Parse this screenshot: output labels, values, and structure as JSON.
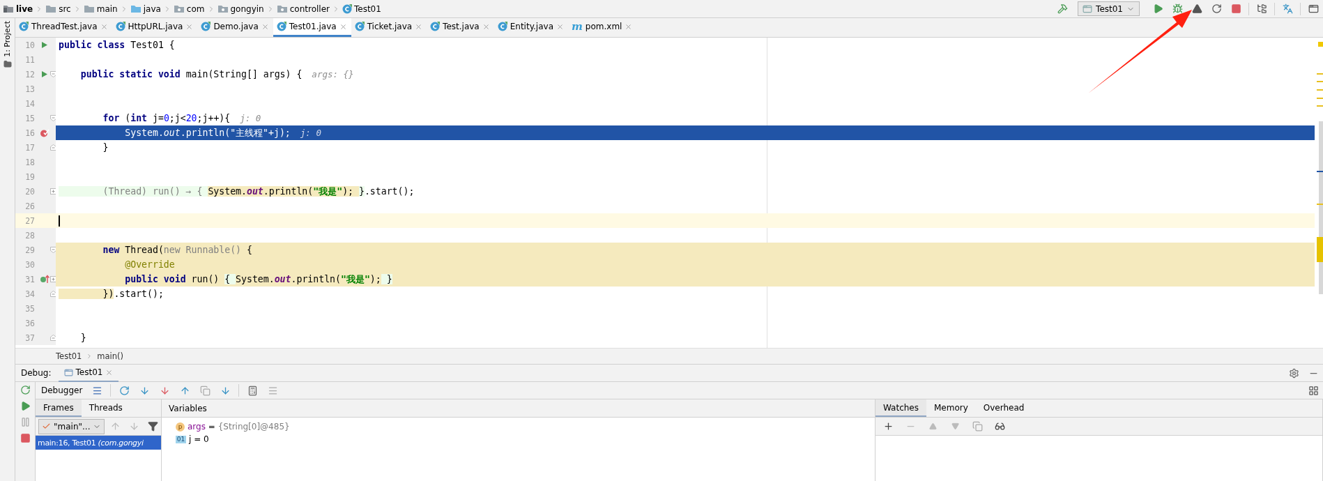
{
  "breadcrumbs": [
    {
      "label": "live",
      "kind": "project"
    },
    {
      "label": "src",
      "kind": "folder"
    },
    {
      "label": "main",
      "kind": "folder"
    },
    {
      "label": "java",
      "kind": "source"
    },
    {
      "label": "com",
      "kind": "package"
    },
    {
      "label": "gongyin",
      "kind": "package"
    },
    {
      "label": "controller",
      "kind": "package"
    },
    {
      "label": "Test01",
      "kind": "class"
    }
  ],
  "run_config": "Test01",
  "side_strip": "1: Project",
  "tabs": [
    {
      "label": "ThreadTest.java",
      "kind": "class",
      "selected": false
    },
    {
      "label": "HttpURL.java",
      "kind": "class",
      "selected": false
    },
    {
      "label": "Demo.java",
      "kind": "class",
      "selected": false
    },
    {
      "label": "Test01.java",
      "kind": "class",
      "selected": true
    },
    {
      "label": "Ticket.java",
      "kind": "class",
      "selected": false
    },
    {
      "label": "Test.java",
      "kind": "class",
      "selected": false
    },
    {
      "label": "Entity.java",
      "kind": "class",
      "selected": false
    },
    {
      "label": "pom.xml",
      "kind": "maven",
      "badge": "m",
      "selected": false
    }
  ],
  "editor": {
    "lines": [
      {
        "number": "10",
        "run_marker": true,
        "tokens": [
          {
            "kind": "kw",
            "text": "public class "
          },
          {
            "kind": "plain",
            "text": "Test01 {"
          }
        ]
      },
      {
        "number": "11"
      },
      {
        "number": "12",
        "run_marker": true,
        "fold_start": true,
        "tokens": [
          {
            "kind": "kw",
            "text": "    public static void "
          },
          {
            "kind": "plain",
            "text": "main(String[] args) {"
          }
        ],
        "hint": "args: {}"
      },
      {
        "number": "13"
      },
      {
        "number": "14"
      },
      {
        "number": "15",
        "fold_start": true,
        "tokens": [
          {
            "kind": "kw",
            "text": "        for "
          },
          {
            "kind": "plain",
            "text": "("
          },
          {
            "kind": "kw",
            "text": "int "
          },
          {
            "kind": "plain",
            "text": "j="
          },
          {
            "kind": "num",
            "text": "0"
          },
          {
            "kind": "plain",
            "text": ";j<"
          },
          {
            "kind": "num",
            "text": "20"
          },
          {
            "kind": "plain",
            "text": ";j++){"
          }
        ],
        "hint": "j: 0"
      },
      {
        "number": "16",
        "breakpoint": true,
        "execution_point": true,
        "tokens": [
          {
            "kind": "plain",
            "text": "            System."
          },
          {
            "kind": "field",
            "text": "out"
          },
          {
            "kind": "plain",
            "text": ".println("
          },
          {
            "kind": "str",
            "text": "\"主线程\""
          },
          {
            "kind": "plain",
            "text": "+j);"
          }
        ],
        "hint": "j: 0"
      },
      {
        "number": "17",
        "fold_end": true,
        "tokens": [
          {
            "kind": "plain",
            "text": "        }"
          }
        ]
      },
      {
        "number": "18"
      },
      {
        "number": "19"
      },
      {
        "number": "20",
        "folded": true,
        "tokens": [
          {
            "kind": "grey",
            "text": "        (Thread) run() → { ",
            "lambda": true
          },
          {
            "kind": "plain",
            "text": "System.",
            "usage": true
          },
          {
            "kind": "field",
            "text": "out",
            "usage": true
          },
          {
            "kind": "plain",
            "text": ".println(",
            "usage": true
          },
          {
            "kind": "str",
            "text": "\"我是\"",
            "usage": true
          },
          {
            "kind": "plain",
            "text": "); ",
            "usage": true
          },
          {
            "kind": "plain",
            "text": "}",
            "lambda": true
          },
          {
            "kind": "plain",
            "text": ".start();"
          }
        ]
      },
      {
        "number": "26"
      },
      {
        "number": "27",
        "caret_line": true
      },
      {
        "number": "28"
      },
      {
        "number": "29",
        "fold_start": true,
        "in_block": true,
        "tokens": [
          {
            "kind": "kw",
            "text": "        new "
          },
          {
            "kind": "plain",
            "text": "Thread("
          },
          {
            "kind": "grey",
            "text": "new Runnable() "
          },
          {
            "kind": "plain",
            "text": "{"
          }
        ]
      },
      {
        "number": "30",
        "in_block": true,
        "tokens": [
          {
            "kind": "anno",
            "text": "            @Override"
          }
        ]
      },
      {
        "number": "31",
        "override_marker": true,
        "folded": true,
        "in_block": true,
        "tokens": [
          {
            "kind": "kw",
            "text": "            public void "
          },
          {
            "kind": "plain",
            "text": "run() "
          },
          {
            "kind": "plain",
            "text": "{ ",
            "lambda": true
          },
          {
            "kind": "plain",
            "text": "System."
          },
          {
            "kind": "field",
            "text": "out"
          },
          {
            "kind": "plain",
            "text": ".println("
          },
          {
            "kind": "str",
            "text": "\"我是\""
          },
          {
            "kind": "plain",
            "text": ");"
          },
          {
            "kind": "plain",
            "text": " }",
            "lambda": true
          }
        ]
      },
      {
        "number": "34",
        "fold_end": true,
        "tokens": [
          {
            "kind": "plain",
            "text": "        })",
            "usage": true
          },
          {
            "kind": "plain",
            "text": ".start();"
          }
        ]
      },
      {
        "number": "35"
      },
      {
        "number": "36"
      },
      {
        "number": "37",
        "fold_end": true,
        "tokens": [
          {
            "kind": "plain",
            "text": "    }"
          }
        ]
      }
    ],
    "footer_path": [
      "Test01",
      "main()"
    ]
  },
  "debug": {
    "title": "Debug:",
    "session": "Test01",
    "toolbar_label": "Debugger",
    "frame_tabs": [
      {
        "label": "Frames",
        "selected": true
      },
      {
        "label": "Threads",
        "selected": false
      }
    ],
    "thread": "\"main\"...",
    "frames": [
      {
        "location": "main:16, Test01",
        "package": "(com.gongyi",
        "selected": true
      }
    ],
    "variables_title": "Variables",
    "variables": [
      {
        "kind": "param",
        "badge": "p",
        "name": "args",
        "sign": "=",
        "value": "{String[0]@485}"
      },
      {
        "kind": "primitive",
        "badge": "01",
        "name": "j",
        "sign": "=",
        "value": "0"
      }
    ],
    "side_tabs": [
      {
        "label": "Watches",
        "selected": true
      },
      {
        "label": "Memory",
        "selected": false
      },
      {
        "label": "Overhead",
        "selected": false
      }
    ]
  }
}
